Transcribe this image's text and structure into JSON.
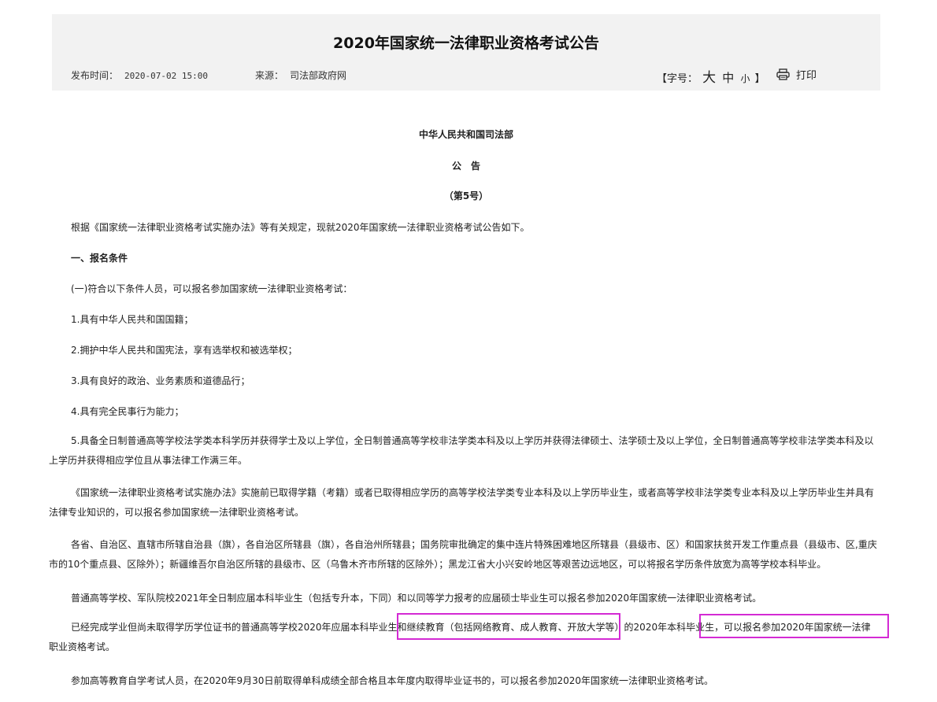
{
  "header": {
    "title": "2020年国家统一法律职业资格考试公告",
    "date_label": "发布时间：",
    "date_value": "2020-07-02 15:00",
    "source_label": "来源：",
    "source_value": "司法部政府网",
    "fontsize_open": "【字号：",
    "fontsize_big": "大",
    "fontsize_mid": "中",
    "fontsize_small": "小",
    "fontsize_close": "】",
    "print_label": "打印"
  },
  "article": {
    "org": "中华人民共和国司法部",
    "notice": "公　告",
    "number": "（第5号）",
    "intro": "根据《国家统一法律职业资格考试实施办法》等有关规定，现就2020年国家统一法律职业资格考试公告如下。",
    "section1": "一、报名条件",
    "cond_intro": "(一)符合以下条件人员，可以报名参加国家统一法律职业资格考试：",
    "cond1": "1.具有中华人民共和国国籍；",
    "cond2": "2.拥护中华人民共和国宪法，享有选举权和被选举权；",
    "cond3": "3.具有良好的政治、业务素质和道德品行；",
    "cond4": "4.具有完全民事行为能力；",
    "cond5": "5.具备全日制普通高等学校法学类本科学历并获得学士及以上学位，全日制普通高等学校非法学类本科及以上学历并获得法律硕士、法学硕士及以上学位，全日制普通高等学校非法学类本科及以上学历并获得相应学位且从事法律工作满三年。",
    "para_a": "《国家统一法律职业资格考试实施办法》实施前已取得学籍（考籍）或者已取得相应学历的高等学校法学类专业本科及以上学历毕业生，或者高等学校非法学类专业本科及以上学历毕业生并具有法律专业知识的，可以报名参加国家统一法律职业资格考试。",
    "para_b": "各省、自治区、直辖市所辖自治县（旗），各自治区所辖县（旗），各自治州所辖县；国务院审批确定的集中连片特殊困难地区所辖县（县级市、区）和国家扶贫开发工作重点县（县级市、区,重庆市的10个重点县、区除外）；新疆维吾尔自治区所辖的县级市、区（乌鲁木齐市所辖的区除外）；黑龙江省大小兴安岭地区等艰苦边远地区，可以将报名学历条件放宽为高等学校本科毕业。",
    "para_c": "普通高等学校、军队院校2021年全日制应届本科毕业生（包括专升本，下同）和以同等学力报考的应届硕士毕业生可以报名参加2020年国家统一法律职业资格考试。",
    "para_d": "已经完成学业但尚未取得学历学位证书的普通高等学校2020年应届本科毕业生和继续教育（包括网络教育、成人教育、开放大学等）的2020年本科毕业生，可以报名参加2020年国家统一法律职业资格考试。",
    "para_e": "参加高等教育自学考试人员，在2020年9月30日前取得单科成绩全部合格且本年度内取得毕业证书的，可以报名参加2020年国家统一法律职业资格考试。"
  },
  "colors": {
    "header_bg": "#f2f2f2",
    "highlight": "#d42ad4"
  }
}
